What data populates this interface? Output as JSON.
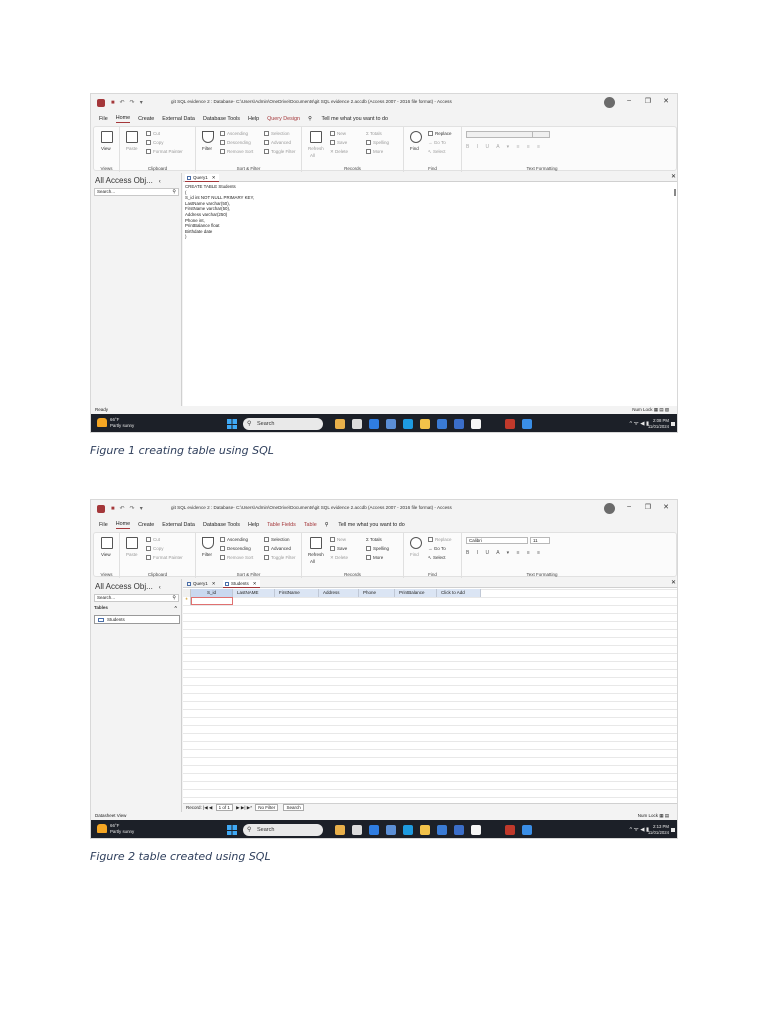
{
  "figures": [
    {
      "title": "git SQL evidence 2 : Database- C:\\Users\\Admin\\OneDrive\\Documents\\git SQL evidence 2.accdb (Access 2007 - 2016 file format) - Access",
      "menu": [
        "File",
        "Home",
        "Create",
        "External Data",
        "Database Tools",
        "Help"
      ],
      "context_tabs": [
        "Query Design"
      ],
      "tell_me": "Tell me what you want to do",
      "tabs": [
        {
          "label": "Query1",
          "active": true
        }
      ],
      "sql_lines": [
        "CREATE TABLE Students",
        "(",
        "S_id int NOT NULL PRIMARY KEY,",
        "LastName varchar(50),",
        "FirstName varchar(50),",
        "Address varchar(250)",
        "Phone int,",
        "PrintBalance float",
        "Birthdate date",
        ")"
      ],
      "status_left": "Ready",
      "status_right": "Num Lock",
      "clock_time": "2:08 PM",
      "clock_date": "11/01/2024",
      "caption": "Figure 1 creating table using SQL"
    },
    {
      "title": "git SQL evidence 2 : Database- C:\\Users\\Admin\\OneDrive\\Documents\\git SQL evidence 2.accdb (Access 2007 - 2016 file format) - Access",
      "menu": [
        "File",
        "Home",
        "Create",
        "External Data",
        "Database Tools",
        "Help"
      ],
      "context_tabs": [
        "Table Fields",
        "Table"
      ],
      "tell_me": "Tell me what you want to do",
      "tabs": [
        {
          "label": "Query1",
          "active": false
        },
        {
          "label": "Students",
          "active": true
        }
      ],
      "nav_section": "Tables",
      "nav_item": "Students",
      "columns": [
        "S_id",
        "LastNAME",
        "FirstName",
        "Address",
        "Phone",
        "PrintBalance",
        "Click to Add"
      ],
      "record_nav": {
        "label": "Record:",
        "position": "1 of 1",
        "filter": "No Filter",
        "search": "Search"
      },
      "status_left": "Datasheet View",
      "status_right": "Num Lock",
      "clock_time": "2:13 PM",
      "clock_date": "11/01/2024",
      "caption": "Figure 2 table created using SQL"
    }
  ],
  "shared": {
    "nav_title": "All Access Obj...",
    "nav_search": "Search...",
    "weather_temp": "66°F",
    "weather_desc": "Partly sunny",
    "taskbar_search": "Search",
    "ribbon": {
      "views": "Views",
      "view": "View",
      "clipboard": "Clipboard",
      "paste": "Paste",
      "cut": "Cut",
      "copy": "Copy",
      "format_painter": "Format Painter",
      "sort_filter": "Sort & Filter",
      "filter": "Filter",
      "ascending": "Ascending",
      "descending": "Descending",
      "remove_sort": "Remove Sort",
      "selection": "Selection",
      "advanced": "Advanced",
      "toggle_filter": "Toggle Filter",
      "records": "Records",
      "refresh": "Refresh",
      "refresh_all": "All",
      "new": "New",
      "save": "Save",
      "delete": "Delete",
      "totals": "Totals",
      "spelling": "Spelling",
      "more": "More",
      "find_group": "Find",
      "find": "Find",
      "replace": "Replace",
      "goto": "Go To",
      "select": "Select",
      "text_formatting": "Text Formatting",
      "font": "Calibri",
      "size": "11"
    }
  }
}
